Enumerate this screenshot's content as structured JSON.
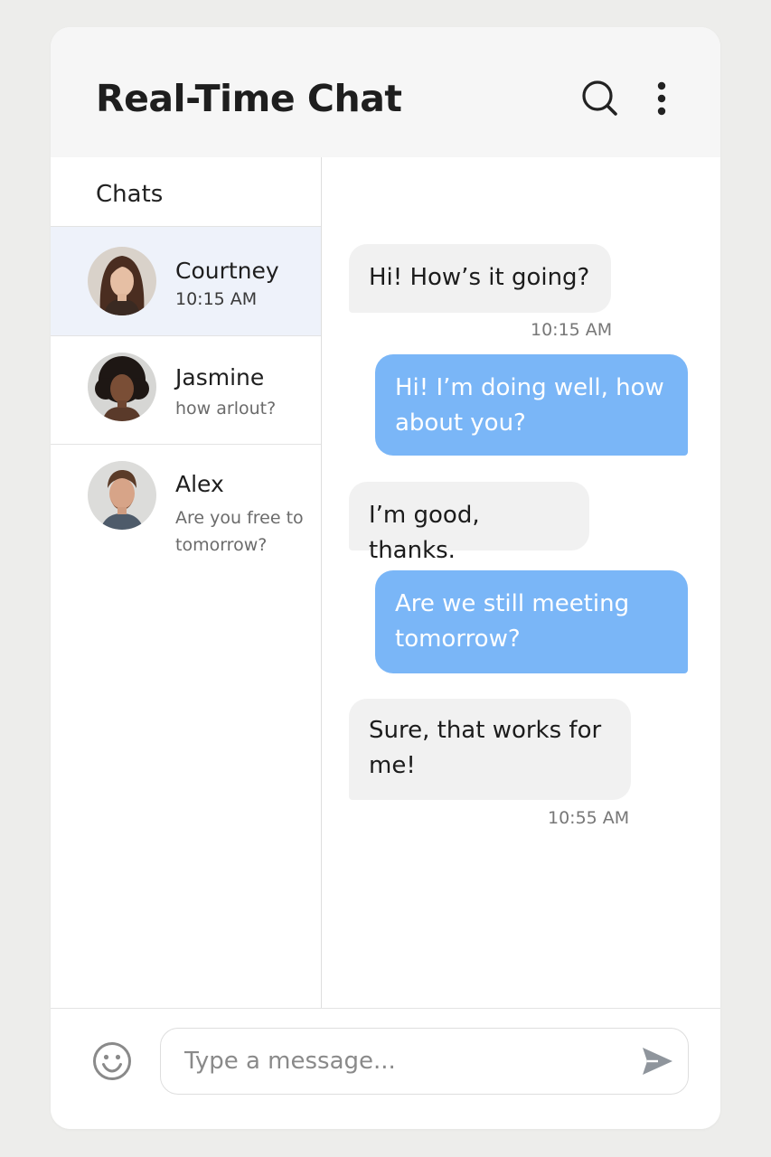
{
  "header": {
    "title": "Real-Time Chat",
    "icons": [
      "search-icon",
      "more-vertical-icon"
    ]
  },
  "sidebar": {
    "title": "Chats",
    "chats": [
      {
        "name": "Courtney",
        "subtitle": "10:15 AM",
        "active": true
      },
      {
        "name": "Jasmine",
        "subtitle": "how arlout?",
        "active": false
      },
      {
        "name": "Alex",
        "subtitle": "Are you free to tomorrow?",
        "active": false
      }
    ]
  },
  "messages": [
    {
      "direction": "incoming",
      "text": "Hi! How’s it going?",
      "time": "10:15 AM"
    },
    {
      "direction": "outgoing",
      "text": "Hi! I’m doing well, how about you?"
    },
    {
      "direction": "incoming",
      "text": "I’m good, thanks."
    },
    {
      "direction": "outgoing",
      "text": "Are we still meeting tomorrow?"
    },
    {
      "direction": "incoming",
      "text": "Sure, that works for me!",
      "time": "10:55 AM"
    }
  ],
  "composer": {
    "placeholder": "Type a message...",
    "value": "",
    "icons": [
      "emoji-icon",
      "send-icon"
    ]
  },
  "colors": {
    "outgoing_bubble": "#7ab6f7",
    "incoming_bubble": "#f1f1f1",
    "active_chat": "#eef2fa",
    "header_bg": "#f6f6f6",
    "page_bg": "#ededeb"
  }
}
